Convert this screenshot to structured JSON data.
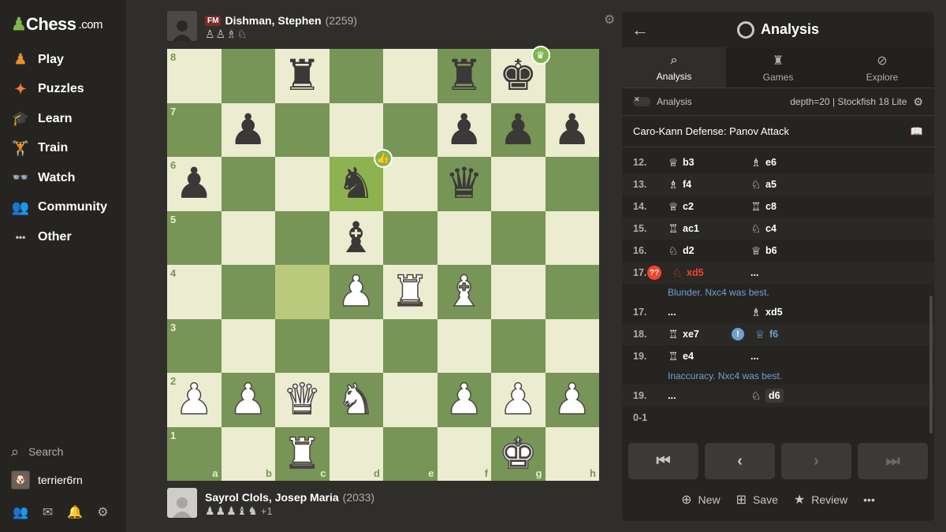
{
  "sidebar": {
    "logo_text": "Chess",
    "logo_tld": ".com",
    "nav": [
      {
        "label": "Play",
        "icon": "play-icon"
      },
      {
        "label": "Puzzles",
        "icon": "puzzles-icon"
      },
      {
        "label": "Learn",
        "icon": "learn-icon"
      },
      {
        "label": "Train",
        "icon": "train-icon"
      },
      {
        "label": "Watch",
        "icon": "watch-icon"
      },
      {
        "label": "Community",
        "icon": "community-icon"
      },
      {
        "label": "Other",
        "icon": "other-icon"
      }
    ],
    "search_label": "Search",
    "username": "terrier6rn"
  },
  "players": {
    "top": {
      "title": "FM",
      "name": "Dishman, Stephen",
      "rating": "(2259)",
      "captured": "♙♙♗♘"
    },
    "bottom": {
      "name": "Sayrol Clols, Josep Maria",
      "rating": "(2033)",
      "captured": "♟♟♟♝♞",
      "advantage": "+1"
    }
  },
  "board": {
    "colors": {
      "light": "#ebecd0",
      "dark": "#779556",
      "highlight_light": "#b9ca7d",
      "highlight_dark": "#8db24f"
    },
    "files": [
      "a",
      "b",
      "c",
      "d",
      "e",
      "f",
      "g",
      "h"
    ],
    "ranks": [
      "8",
      "7",
      "6",
      "5",
      "4",
      "3",
      "2",
      "1"
    ],
    "highlighted": [
      "c4",
      "d6"
    ],
    "pieces": {
      "c8": "bR",
      "f8": "bR",
      "g8": "bK",
      "b7": "bP",
      "f7": "bP",
      "g7": "bP",
      "h7": "bP",
      "a6": "bP",
      "d6": "bN",
      "f6": "bQ",
      "d5": "bB",
      "d4": "wP",
      "e4": "wR",
      "f4": "wB",
      "a2": "wP",
      "b2": "wP",
      "c2": "wQ",
      "d2": "wN",
      "f2": "wP",
      "g2": "wP",
      "h2": "wP",
      "c1": "wR",
      "g1": "wK"
    },
    "best_move_square": "d6",
    "winner_square": "g8"
  },
  "panel": {
    "back_icon": "back-arrow-icon",
    "title": "Analysis",
    "tabs": [
      {
        "label": "Analysis",
        "icon": "analysis-icon",
        "active": true
      },
      {
        "label": "Games",
        "icon": "games-icon",
        "active": false
      },
      {
        "label": "Explore",
        "icon": "explore-icon",
        "active": false
      }
    ],
    "analysis_toggle_label": "Analysis",
    "engine_info": "depth=20 | Stockfish 18 Lite",
    "opening": "Caro-Kann Defense: Panov Attack",
    "moves": [
      {
        "num": "12.",
        "white": {
          "icon": "♕",
          "san": "b3"
        },
        "black": {
          "icon": "♗",
          "san": "e6"
        }
      },
      {
        "num": "13.",
        "white": {
          "icon": "♗",
          "san": "f4"
        },
        "black": {
          "icon": "♘",
          "san": "a5"
        }
      },
      {
        "num": "14.",
        "white": {
          "icon": "♕",
          "san": "c2"
        },
        "black": {
          "icon": "♖",
          "san": "c8"
        }
      },
      {
        "num": "15.",
        "white": {
          "icon": "♖",
          "san": "ac1"
        },
        "black": {
          "icon": "♘",
          "san": "c4"
        }
      },
      {
        "num": "16.",
        "white": {
          "icon": "♘",
          "san": "d2"
        },
        "black": {
          "icon": "♕",
          "san": "b6"
        }
      },
      {
        "num": "17.",
        "white": {
          "icon": "♘",
          "san": "xd5",
          "badge": "??",
          "class": "red"
        },
        "black": {
          "icon": "",
          "san": "..."
        },
        "note": "Blunder. Nxc4 was best."
      },
      {
        "num": "17.",
        "white": {
          "icon": "",
          "san": "..."
        },
        "black": {
          "icon": "♗",
          "san": "xd5"
        }
      },
      {
        "num": "18.",
        "white": {
          "icon": "♖",
          "san": "xe7"
        },
        "black": {
          "icon": "♕",
          "san": "f6",
          "badge": "!",
          "class": "blue"
        }
      },
      {
        "num": "19.",
        "white": {
          "icon": "♖",
          "san": "e4"
        },
        "black": {
          "icon": "",
          "san": "..."
        },
        "note": "Inaccuracy. Nxc4 was best."
      },
      {
        "num": "19.",
        "white": {
          "icon": "",
          "san": "..."
        },
        "black": {
          "icon": "♘",
          "san": "d6",
          "current": true
        }
      }
    ],
    "result": "0-1",
    "controls": [
      "⏮",
      "‹",
      "›",
      "⏭"
    ],
    "actions": [
      {
        "label": "New",
        "icon": "new-analysis-icon"
      },
      {
        "label": "Save",
        "icon": "save-icon"
      },
      {
        "label": "Review",
        "icon": "review-icon"
      }
    ],
    "more_label": "•••"
  }
}
